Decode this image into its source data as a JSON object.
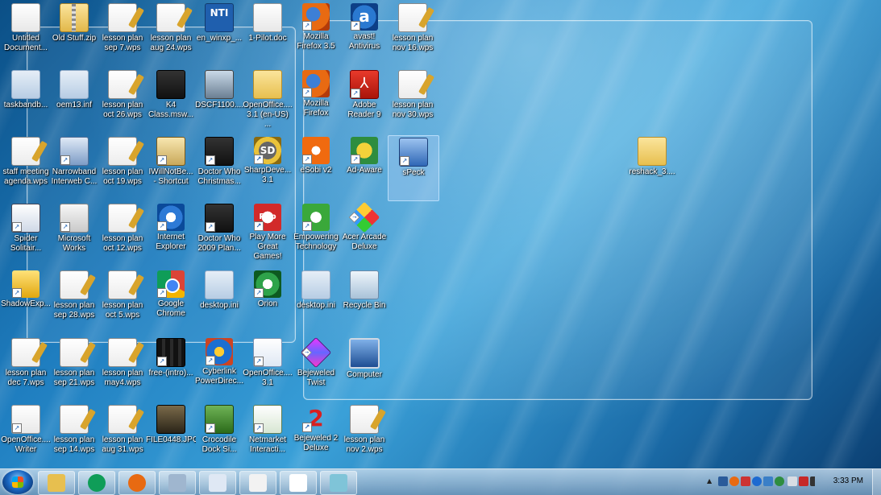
{
  "desktop": {
    "icons": [
      {
        "label": "Untitled\nDocument...",
        "kind": "doc"
      },
      {
        "label": "Old Stuff.zip",
        "kind": "zip"
      },
      {
        "label": "lesson plan\nsep 7.wps",
        "kind": "wps"
      },
      {
        "label": "lesson plan\naug 24.wps",
        "kind": "wps"
      },
      {
        "label": "en_winxp_...",
        "kind": "nti"
      },
      {
        "label": "1-Pilot.doc",
        "kind": "doc"
      },
      {
        "label": "Mozilla\nFirefox 3.5",
        "kind": "firefox",
        "shortcut": true
      },
      {
        "label": "avast!\nAntivirus",
        "kind": "avast",
        "shortcut": true
      },
      {
        "label": "lesson plan\nnov 16.wps",
        "kind": "wps"
      },
      {
        "label": "taskbandb...",
        "kind": "ini"
      },
      {
        "label": "oem13.inf",
        "kind": "ini"
      },
      {
        "label": "lesson plan\noct 26.wps",
        "kind": "wps"
      },
      {
        "label": "K4\nClass.msw...",
        "kind": "video"
      },
      {
        "label": "DSCF1100....",
        "kind": "photo"
      },
      {
        "label": "OpenOffice....\n3.1 (en-US) ...",
        "kind": "folder"
      },
      {
        "label": "Mozilla\nFirefox",
        "kind": "firefox",
        "shortcut": true
      },
      {
        "label": "Adobe\nReader 9",
        "kind": "acrobat",
        "shortcut": true
      },
      {
        "label": "lesson plan\nnov 30.wps",
        "kind": "wps"
      },
      {
        "label": "staff meeting\nagenda.wps",
        "kind": "wps"
      },
      {
        "label": "Narrowband\nInterweb C...",
        "kind": "narrow",
        "shortcut": true
      },
      {
        "label": "lesson plan\noct 19.wps",
        "kind": "wps"
      },
      {
        "label": "IWillNotBe...\n- Shortcut",
        "kind": "certificate",
        "shortcut": true
      },
      {
        "label": "Doctor Who\nChristmas...",
        "kind": "video",
        "shortcut": true
      },
      {
        "label": "SharpDeve...\n3.1",
        "kind": "sd",
        "shortcut": true
      },
      {
        "label": "eSobi v2",
        "kind": "esobi",
        "shortcut": true
      },
      {
        "label": "Ad-Aware",
        "kind": "adaware",
        "shortcut": true
      },
      {
        "label": "sPeck",
        "kind": "speck",
        "shortcut": true,
        "selected": true
      },
      {
        "label": "Spider\nSolitair...",
        "kind": "spider",
        "shortcut": true
      },
      {
        "label": "Microsoft\nWorks",
        "kind": "works",
        "shortcut": true
      },
      {
        "label": "lesson plan\noct 12.wps",
        "kind": "wps"
      },
      {
        "label": "Internet\nExplorer",
        "kind": "ie",
        "shortcut": true
      },
      {
        "label": "Doctor Who\n2009 Plan...",
        "kind": "video",
        "shortcut": true
      },
      {
        "label": "Play More\nGreat Games!",
        "kind": "popcap",
        "shortcut": true
      },
      {
        "label": "Empowering\nTechnology",
        "kind": "empower",
        "shortcut": true
      },
      {
        "label": "Acer Arcade\nDeluxe",
        "kind": "acer",
        "shortcut": true
      },
      {
        "label": "ShadowExp...",
        "kind": "shadow",
        "shortcut": true
      },
      {
        "label": "lesson plan\nsep 28.wps",
        "kind": "wps"
      },
      {
        "label": "lesson plan\noct 5.wps",
        "kind": "wps"
      },
      {
        "label": "Google\nChrome",
        "kind": "chrome",
        "shortcut": true
      },
      {
        "label": "desktop.ini",
        "kind": "ini"
      },
      {
        "label": "Orion",
        "kind": "orion",
        "shortcut": true
      },
      {
        "label": "desktop.ini",
        "kind": "ini"
      },
      {
        "label": "Recycle Bin",
        "kind": "recycle"
      },
      {
        "label": "lesson plan\ndec 7.wps",
        "kind": "wps"
      },
      {
        "label": "lesson plan\nsep 21.wps",
        "kind": "wps"
      },
      {
        "label": "lesson plan\nmay4.wps",
        "kind": "wps"
      },
      {
        "label": "free-(intro)...",
        "kind": "film",
        "shortcut": true
      },
      {
        "label": "Cyberlink\nPowerDirec...",
        "kind": "cyber",
        "shortcut": true
      },
      {
        "label": "OpenOffice....\n3.1",
        "kind": "oo",
        "shortcut": true
      },
      {
        "label": "Bejeweled\nTwist",
        "kind": "jewel",
        "shortcut": true
      },
      {
        "label": "Computer",
        "kind": "computer"
      },
      {
        "label": "OpenOffice....\nWriter",
        "kind": "doc",
        "shortcut": true
      },
      {
        "label": "lesson plan\nsep 14.wps",
        "kind": "wps"
      },
      {
        "label": "lesson plan\naug 31.wps",
        "kind": "wps"
      },
      {
        "label": "FILE0448.JPG",
        "kind": "jpg"
      },
      {
        "label": "Crocodile\nDock Si...",
        "kind": "croc",
        "shortcut": true
      },
      {
        "label": "Netmarket\nInteracti...",
        "kind": "net",
        "shortcut": true
      },
      {
        "label": "Bejeweled 2\nDeluxe",
        "kind": "num2",
        "shortcut": true
      },
      {
        "label": "lesson plan\nnov 2.wps",
        "kind": "wps"
      },
      {
        "label": "reshack_3....",
        "kind": "folder"
      }
    ]
  },
  "taskbar": {
    "pinned": [
      {
        "name": "windows-explorer",
        "color": "#e7bf4f"
      },
      {
        "name": "google-chrome",
        "color": "#0f9d58"
      },
      {
        "name": "mozilla-firefox",
        "color": "#e86a12"
      },
      {
        "name": "calculator",
        "color": "#9fb6cf"
      },
      {
        "name": "document-viewer",
        "color": "#dfe8f4"
      },
      {
        "name": "wordpad",
        "color": "#f2f2f2"
      },
      {
        "name": "blank-document",
        "color": "#ffffff"
      },
      {
        "name": "snipping-tool",
        "color": "#7fc4d8"
      }
    ],
    "tray": {
      "show_hidden_label": "▲",
      "clock": "3:33 PM"
    }
  }
}
